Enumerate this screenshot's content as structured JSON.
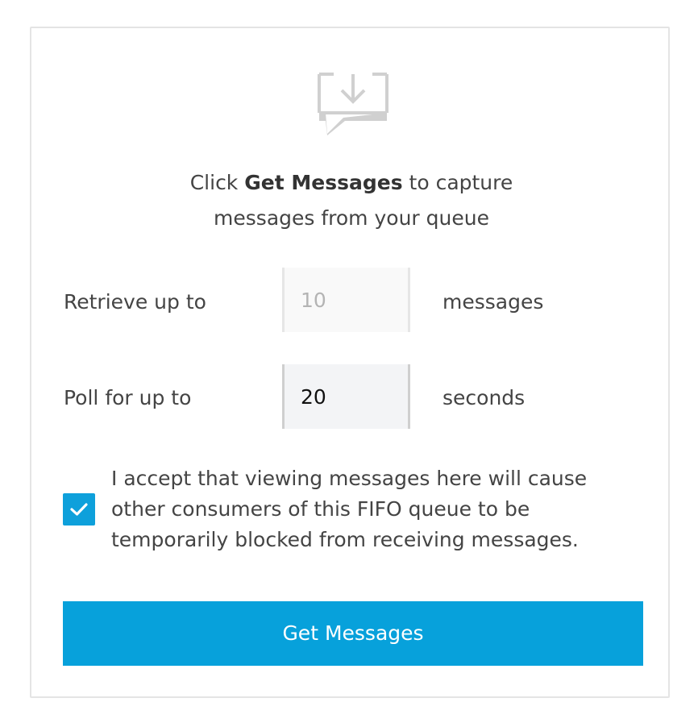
{
  "intro": {
    "prefix": "Click",
    "bold": "Get Messages",
    "suffix": "to capture",
    "line2": "messages from your queue"
  },
  "retrieve": {
    "label": "Retrieve up to",
    "value": "10",
    "unit": "messages",
    "disabled": true
  },
  "poll": {
    "label": "Poll for up to",
    "value": "20",
    "unit": "seconds"
  },
  "accept": {
    "checked": true,
    "text": "I accept that viewing messages here will cause other consumers of this FIFO queue to be temporarily blocked from receiving messages."
  },
  "button": {
    "label": "Get Messages"
  },
  "colors": {
    "accent": "#07a1db",
    "icon": "#d0d0d0"
  },
  "icons": {
    "header": "inbox-download-icon",
    "check": "checkmark-icon"
  }
}
